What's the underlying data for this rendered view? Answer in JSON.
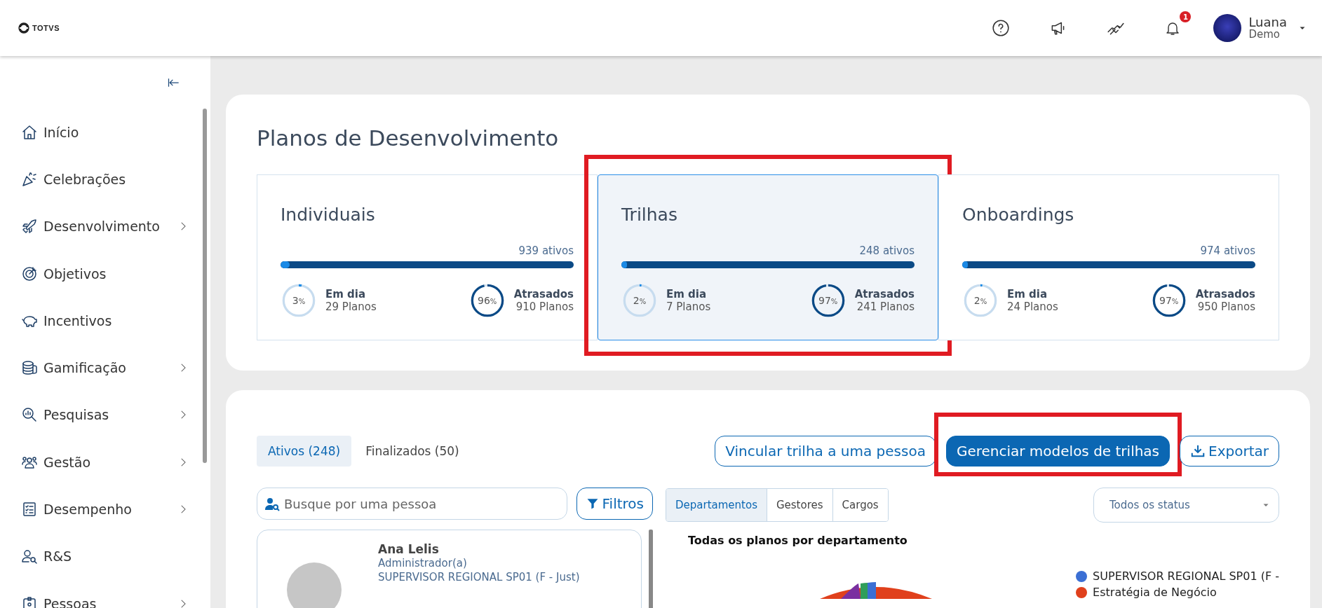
{
  "header": {
    "logo": "TOTVS",
    "notifications_badge": "1",
    "user": {
      "name": "Luana",
      "subtitle": "Demo"
    }
  },
  "sidebar": {
    "items": [
      {
        "label": "Início",
        "has_children": false
      },
      {
        "label": "Celebrações",
        "has_children": false
      },
      {
        "label": "Desenvolvimento",
        "has_children": true
      },
      {
        "label": "Objetivos",
        "has_children": false
      },
      {
        "label": "Incentivos",
        "has_children": false
      },
      {
        "label": "Gamificação",
        "has_children": true
      },
      {
        "label": "Pesquisas",
        "has_children": true
      },
      {
        "label": "Gestão",
        "has_children": true
      },
      {
        "label": "Desempenho",
        "has_children": true
      },
      {
        "label": "R&S",
        "has_children": false
      },
      {
        "label": "Pessoas",
        "has_children": true
      }
    ]
  },
  "summary": {
    "title": "Planos de Desenvolvimento",
    "cards": [
      {
        "title": "Individuais",
        "active": "939 ativos",
        "level": 0.03,
        "selected": false,
        "highlighted": false,
        "on_time": {
          "percent": "3",
          "unit": "%",
          "level": 0.03,
          "label": "Em dia",
          "count": "29 Planos"
        },
        "late": {
          "percent": "96",
          "unit": "%",
          "level": 0.96,
          "label": "Atrasados",
          "count": "910 Planos"
        }
      },
      {
        "title": "Trilhas",
        "active": "248 ativos",
        "level": 0.02,
        "selected": true,
        "highlighted": true,
        "on_time": {
          "percent": "2",
          "unit": "%",
          "level": 0.02,
          "label": "Em dia",
          "count": "7 Planos"
        },
        "late": {
          "percent": "97",
          "unit": "%",
          "level": 0.97,
          "label": "Atrasados",
          "count": "241 Planos"
        }
      },
      {
        "title": "Onboardings",
        "active": "974 ativos",
        "level": 0.02,
        "selected": false,
        "highlighted": false,
        "on_time": {
          "percent": "2",
          "unit": "%",
          "level": 0.02,
          "label": "Em dia",
          "count": "24 Planos"
        },
        "late": {
          "percent": "97",
          "unit": "%",
          "level": 0.97,
          "label": "Atrasados",
          "count": "950 Planos"
        }
      }
    ]
  },
  "plans": {
    "tabs": [
      {
        "label": "Ativos (248)",
        "selected": true
      },
      {
        "label": "Finalizados (50)",
        "selected": false
      }
    ],
    "actions": [
      {
        "label": "Vincular trilha a uma pessoa",
        "kind": "outline",
        "highlighted": false
      },
      {
        "label": "Gerenciar modelos de trilhas",
        "kind": "primary",
        "highlighted": true
      },
      {
        "label": "Exportar",
        "kind": "export",
        "highlighted": false
      }
    ],
    "search": {
      "placeholder": "Busque por uma pessoa"
    },
    "filter_button": "Filtros",
    "views": [
      {
        "label": "Departamentos",
        "selected": true
      },
      {
        "label": "Gestores",
        "selected": false
      },
      {
        "label": "Cargos",
        "selected": false
      }
    ],
    "status_select": "Todos os status",
    "people": [
      {
        "name": "Ana Lelis",
        "role": "Administrador(a)",
        "position": "SUPERVISOR REGIONAL SP01 (F - Just)"
      }
    ],
    "chart": {
      "title": "Todas os planos por departamento",
      "legend": [
        {
          "label": "SUPERVISOR REGIONAL SP01 (F -",
          "color": "#3b6fd4"
        },
        {
          "label": "Estratégia de Negócio",
          "color": "#e0401c"
        }
      ]
    }
  }
}
